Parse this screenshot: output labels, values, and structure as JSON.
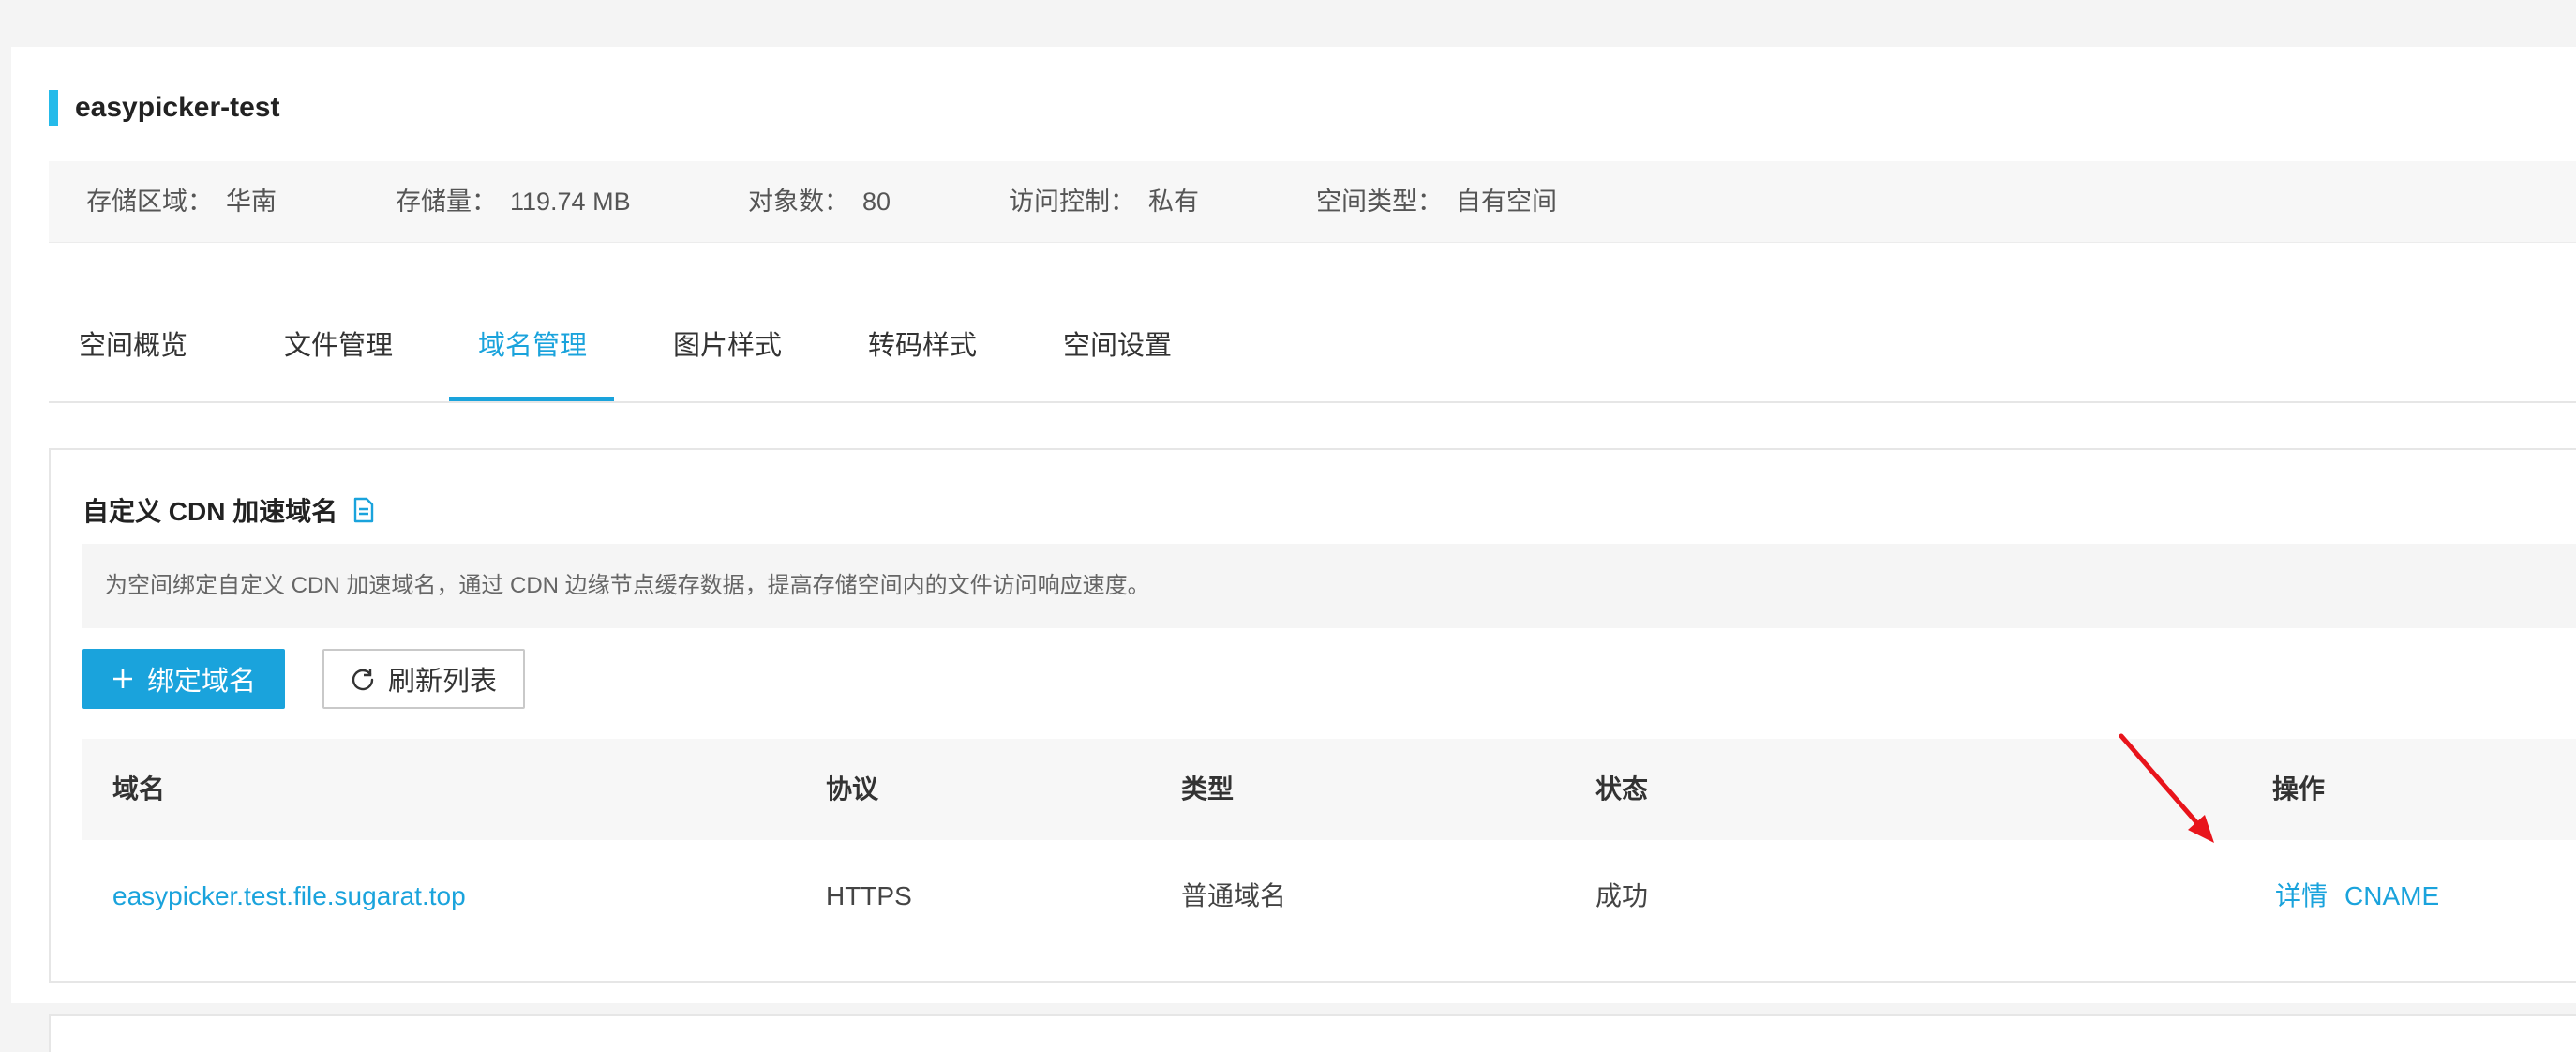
{
  "bucket": {
    "name": "easypicker-test"
  },
  "info": [
    {
      "label": "存储区域：",
      "value": "华南"
    },
    {
      "label": "存储量：",
      "value": "119.74 MB"
    },
    {
      "label": "对象数：",
      "value": "80"
    },
    {
      "label": "访问控制：",
      "value": "私有"
    },
    {
      "label": "空间类型：",
      "value": "自有空间"
    }
  ],
  "tabs": [
    {
      "label": "空间概览",
      "active": false
    },
    {
      "label": "文件管理",
      "active": false
    },
    {
      "label": "域名管理",
      "active": true
    },
    {
      "label": "图片样式",
      "active": false
    },
    {
      "label": "转码样式",
      "active": false
    },
    {
      "label": "空间设置",
      "active": false
    }
  ],
  "cdn": {
    "title": "自定义 CDN 加速域名",
    "title_icon": "doc-icon",
    "tip": "为空间绑定自定义 CDN 加速域名，通过 CDN 边缘节点缓存数据，提高存储空间内的文件访问响应速度。",
    "bind_button": "绑定域名",
    "bind_icon": "plus-icon",
    "refresh_button": "刷新列表",
    "refresh_icon": "refresh-icon"
  },
  "table": {
    "headers": [
      "域名",
      "协议",
      "类型",
      "状态",
      "操作"
    ],
    "rows": [
      {
        "domain": "easypicker.test.file.sugarat.top",
        "protocol": "HTTPS",
        "type": "普通域名",
        "status": "成功",
        "actions": [
          "详情",
          "CNAME"
        ]
      }
    ]
  },
  "colors": {
    "accent": "#1aa3dc",
    "title_accent": "#25bbea",
    "annotation_arrow": "#e8141b"
  }
}
